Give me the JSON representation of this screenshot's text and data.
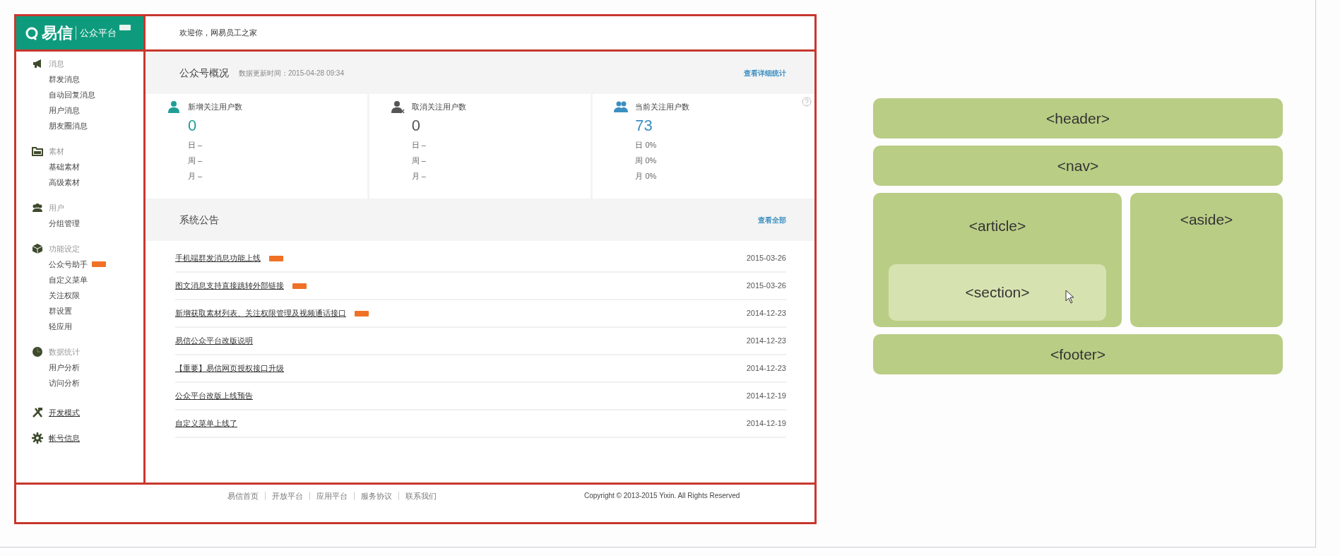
{
  "header": {
    "logo_text": "易信",
    "logo_subtitle": "公众平台",
    "welcome": "欢迎你，网易员工之家"
  },
  "sidebar": {
    "groups": [
      {
        "title": "消息",
        "items": [
          {
            "label": "群发消息",
            "new": false
          },
          {
            "label": "自动回复消息",
            "new": false
          },
          {
            "label": "用户消息",
            "new": false
          },
          {
            "label": "朋友圈消息",
            "new": false
          }
        ]
      },
      {
        "title": "素材",
        "items": [
          {
            "label": "基础素材",
            "new": false
          },
          {
            "label": "高级素材",
            "new": false
          }
        ]
      },
      {
        "title": "用户",
        "items": [
          {
            "label": "分组管理",
            "new": false
          }
        ]
      },
      {
        "title": "功能设定",
        "items": [
          {
            "label": "公众号助手",
            "new": true
          },
          {
            "label": "自定义菜单",
            "new": false
          },
          {
            "label": "关注权限",
            "new": false
          },
          {
            "label": "群设置",
            "new": false
          },
          {
            "label": "轻应用",
            "new": false
          }
        ]
      },
      {
        "title": "数据统计",
        "items": [
          {
            "label": "用户分析",
            "new": false
          },
          {
            "label": "访问分析",
            "new": false
          }
        ]
      },
      {
        "title": "开发模式"
      },
      {
        "title": "帐号信息"
      }
    ]
  },
  "overview": {
    "title": "公众号概况",
    "updated": "数据更新时间：2015-04-28 09:34",
    "link": "查看详细统计",
    "stats": [
      {
        "label": "新增关注用户数",
        "value": "0",
        "color": "#1f9e96",
        "rows": [
          "日 –",
          "周 –",
          "月 –"
        ]
      },
      {
        "label": "取消关注用户数",
        "value": "0",
        "color": "#555555",
        "rows": [
          "日 –",
          "周 –",
          "月 –"
        ]
      },
      {
        "label": "当前关注用户数",
        "value": "73",
        "color": "#3b8fc2",
        "rows": [
          "日 0%",
          "周 0%",
          "月 0%"
        ]
      }
    ]
  },
  "announcements": {
    "title": "系统公告",
    "link": "查看全部",
    "rows": [
      {
        "text": "手机端群发消息功能上线",
        "date": "2015-03-26",
        "new": true
      },
      {
        "text": "图文消息支持直接跳转外部链接",
        "date": "2015-03-26",
        "new": true
      },
      {
        "text": "新增获取素材列表、关注权限管理及视频通话接口",
        "date": "2014-12-23",
        "new": true
      },
      {
        "text": "易信公众平台改版说明",
        "date": "2014-12-23",
        "new": false
      },
      {
        "text": "【重要】易信网页授权接口升级",
        "date": "2014-12-23",
        "new": false
      },
      {
        "text": "公众平台改版上线预告",
        "date": "2014-12-19",
        "new": false
      },
      {
        "text": "自定义菜单上线了",
        "date": "2014-12-19",
        "new": false
      }
    ]
  },
  "footer": {
    "links": [
      "易信首页",
      "开放平台",
      "应用平台",
      "服务协议",
      "联系我们"
    ],
    "copyright": "Copyright © 2013-2015  Yixin. All Rights Reserved"
  },
  "diagram": {
    "header": "<header>",
    "nav": "<nav>",
    "article": "<article>",
    "section": "<section>",
    "aside": "<aside>",
    "footer": "<footer>"
  }
}
